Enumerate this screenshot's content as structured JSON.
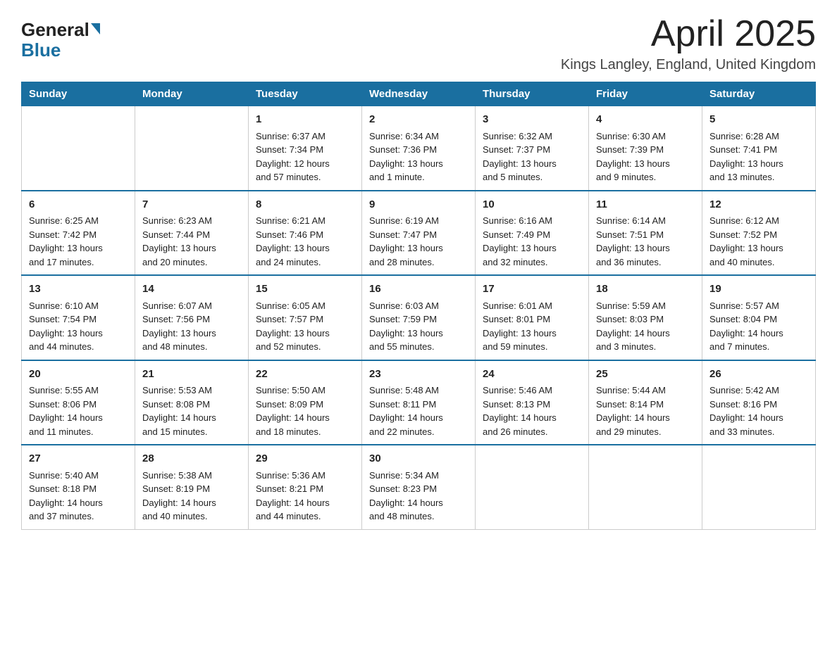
{
  "logo": {
    "general": "General",
    "blue": "Blue"
  },
  "header": {
    "title": "April 2025",
    "subtitle": "Kings Langley, England, United Kingdom"
  },
  "columns": [
    "Sunday",
    "Monday",
    "Tuesday",
    "Wednesday",
    "Thursday",
    "Friday",
    "Saturday"
  ],
  "weeks": [
    [
      {
        "day": "",
        "info": ""
      },
      {
        "day": "",
        "info": ""
      },
      {
        "day": "1",
        "info": "Sunrise: 6:37 AM\nSunset: 7:34 PM\nDaylight: 12 hours\nand 57 minutes."
      },
      {
        "day": "2",
        "info": "Sunrise: 6:34 AM\nSunset: 7:36 PM\nDaylight: 13 hours\nand 1 minute."
      },
      {
        "day": "3",
        "info": "Sunrise: 6:32 AM\nSunset: 7:37 PM\nDaylight: 13 hours\nand 5 minutes."
      },
      {
        "day": "4",
        "info": "Sunrise: 6:30 AM\nSunset: 7:39 PM\nDaylight: 13 hours\nand 9 minutes."
      },
      {
        "day": "5",
        "info": "Sunrise: 6:28 AM\nSunset: 7:41 PM\nDaylight: 13 hours\nand 13 minutes."
      }
    ],
    [
      {
        "day": "6",
        "info": "Sunrise: 6:25 AM\nSunset: 7:42 PM\nDaylight: 13 hours\nand 17 minutes."
      },
      {
        "day": "7",
        "info": "Sunrise: 6:23 AM\nSunset: 7:44 PM\nDaylight: 13 hours\nand 20 minutes."
      },
      {
        "day": "8",
        "info": "Sunrise: 6:21 AM\nSunset: 7:46 PM\nDaylight: 13 hours\nand 24 minutes."
      },
      {
        "day": "9",
        "info": "Sunrise: 6:19 AM\nSunset: 7:47 PM\nDaylight: 13 hours\nand 28 minutes."
      },
      {
        "day": "10",
        "info": "Sunrise: 6:16 AM\nSunset: 7:49 PM\nDaylight: 13 hours\nand 32 minutes."
      },
      {
        "day": "11",
        "info": "Sunrise: 6:14 AM\nSunset: 7:51 PM\nDaylight: 13 hours\nand 36 minutes."
      },
      {
        "day": "12",
        "info": "Sunrise: 6:12 AM\nSunset: 7:52 PM\nDaylight: 13 hours\nand 40 minutes."
      }
    ],
    [
      {
        "day": "13",
        "info": "Sunrise: 6:10 AM\nSunset: 7:54 PM\nDaylight: 13 hours\nand 44 minutes."
      },
      {
        "day": "14",
        "info": "Sunrise: 6:07 AM\nSunset: 7:56 PM\nDaylight: 13 hours\nand 48 minutes."
      },
      {
        "day": "15",
        "info": "Sunrise: 6:05 AM\nSunset: 7:57 PM\nDaylight: 13 hours\nand 52 minutes."
      },
      {
        "day": "16",
        "info": "Sunrise: 6:03 AM\nSunset: 7:59 PM\nDaylight: 13 hours\nand 55 minutes."
      },
      {
        "day": "17",
        "info": "Sunrise: 6:01 AM\nSunset: 8:01 PM\nDaylight: 13 hours\nand 59 minutes."
      },
      {
        "day": "18",
        "info": "Sunrise: 5:59 AM\nSunset: 8:03 PM\nDaylight: 14 hours\nand 3 minutes."
      },
      {
        "day": "19",
        "info": "Sunrise: 5:57 AM\nSunset: 8:04 PM\nDaylight: 14 hours\nand 7 minutes."
      }
    ],
    [
      {
        "day": "20",
        "info": "Sunrise: 5:55 AM\nSunset: 8:06 PM\nDaylight: 14 hours\nand 11 minutes."
      },
      {
        "day": "21",
        "info": "Sunrise: 5:53 AM\nSunset: 8:08 PM\nDaylight: 14 hours\nand 15 minutes."
      },
      {
        "day": "22",
        "info": "Sunrise: 5:50 AM\nSunset: 8:09 PM\nDaylight: 14 hours\nand 18 minutes."
      },
      {
        "day": "23",
        "info": "Sunrise: 5:48 AM\nSunset: 8:11 PM\nDaylight: 14 hours\nand 22 minutes."
      },
      {
        "day": "24",
        "info": "Sunrise: 5:46 AM\nSunset: 8:13 PM\nDaylight: 14 hours\nand 26 minutes."
      },
      {
        "day": "25",
        "info": "Sunrise: 5:44 AM\nSunset: 8:14 PM\nDaylight: 14 hours\nand 29 minutes."
      },
      {
        "day": "26",
        "info": "Sunrise: 5:42 AM\nSunset: 8:16 PM\nDaylight: 14 hours\nand 33 minutes."
      }
    ],
    [
      {
        "day": "27",
        "info": "Sunrise: 5:40 AM\nSunset: 8:18 PM\nDaylight: 14 hours\nand 37 minutes."
      },
      {
        "day": "28",
        "info": "Sunrise: 5:38 AM\nSunset: 8:19 PM\nDaylight: 14 hours\nand 40 minutes."
      },
      {
        "day": "29",
        "info": "Sunrise: 5:36 AM\nSunset: 8:21 PM\nDaylight: 14 hours\nand 44 minutes."
      },
      {
        "day": "30",
        "info": "Sunrise: 5:34 AM\nSunset: 8:23 PM\nDaylight: 14 hours\nand 48 minutes."
      },
      {
        "day": "",
        "info": ""
      },
      {
        "day": "",
        "info": ""
      },
      {
        "day": "",
        "info": ""
      }
    ]
  ]
}
